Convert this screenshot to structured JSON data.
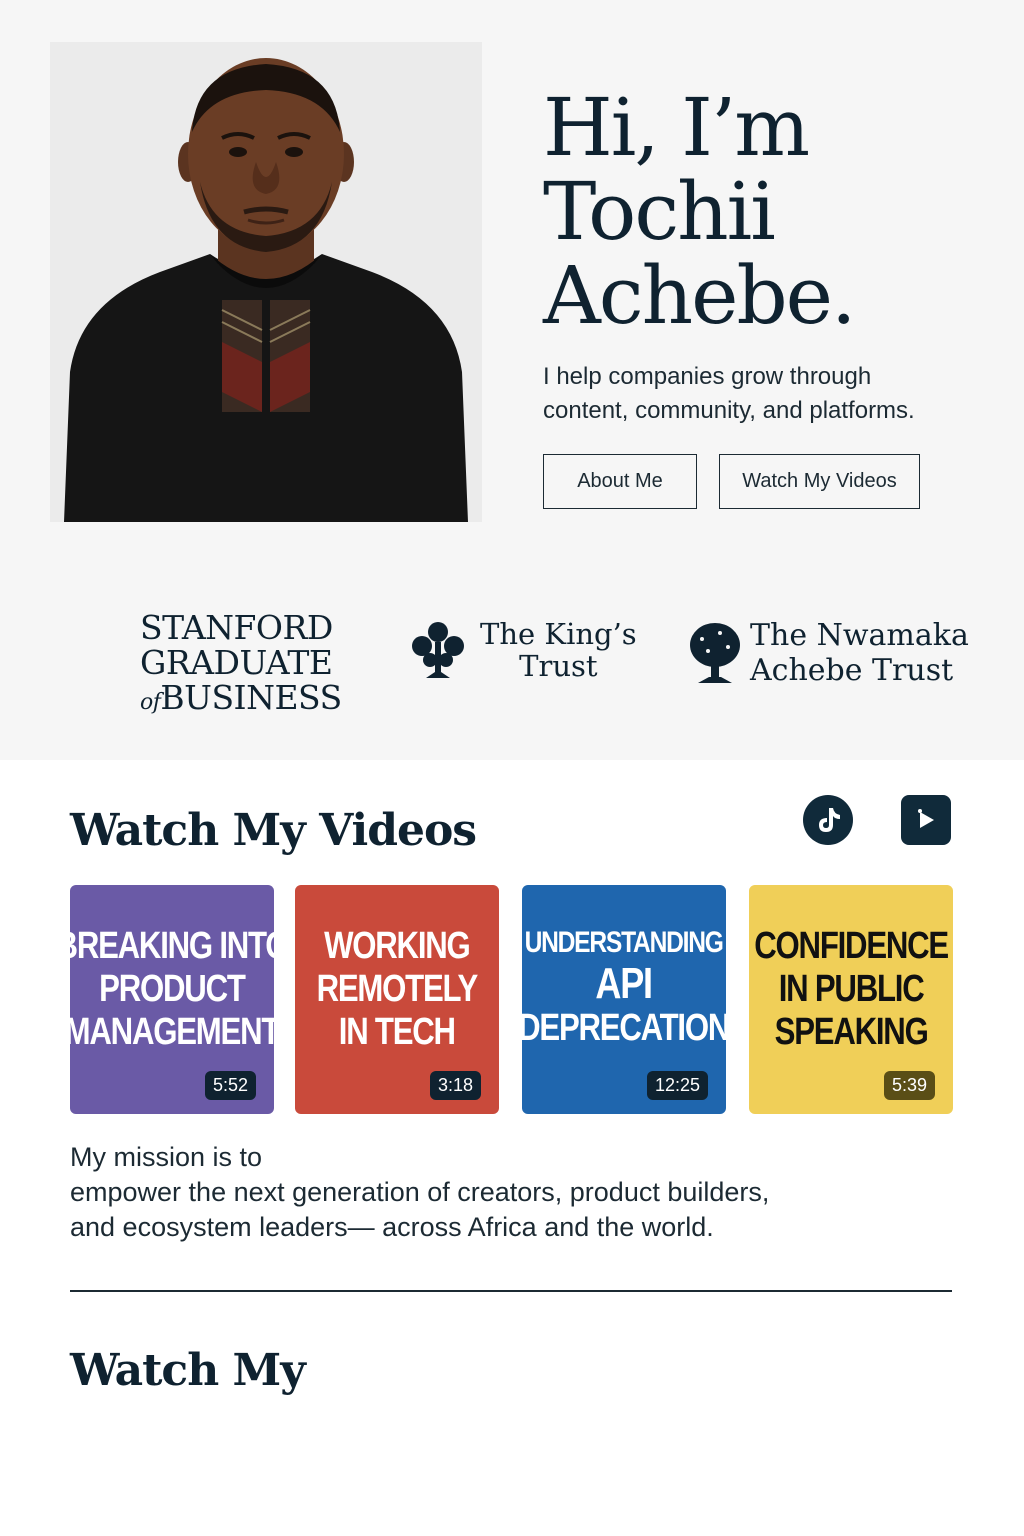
{
  "hero": {
    "headline": [
      "Hi, I’m",
      "Tochii",
      "Achebe."
    ],
    "tagline": [
      "I help companies grow through",
      "content, community, and platforms."
    ],
    "buttons": {
      "about": "About Me",
      "videos": "Watch My Videos"
    },
    "portrait_alt": "Portrait of Tochii Achebe"
  },
  "logos": {
    "stanford": {
      "line1": "STANFORD",
      "line2": "GRADUATE",
      "line3_of": "of",
      "line3": "BUSINESS"
    },
    "kings_trust": {
      "line1": "The King’s",
      "line2": "Trust"
    },
    "nwamaka": {
      "line1": "The Nwamaka",
      "line2": "Achebe Trust"
    }
  },
  "videos_section": {
    "title": "Watch My Videos",
    "social_icons": [
      "tiktok-icon",
      "video-play-icon"
    ],
    "cards": [
      {
        "lines": [
          "Breaking into",
          "Product",
          "Management"
        ],
        "duration": "5:52",
        "color": "#6a5aa6"
      },
      {
        "lines": [
          "Working",
          "Remotely",
          "in Tech"
        ],
        "duration": "3:18",
        "color": "#c94a3b"
      },
      {
        "lines": [
          "Understanding",
          "API",
          "Deprecation"
        ],
        "duration": "12:25",
        "color": "#1f66ae"
      },
      {
        "lines": [
          "Confidence",
          "in Public",
          "Speaking"
        ],
        "duration": "5:39",
        "color": "#f0cf58"
      }
    ]
  },
  "mission": [
    "My mission is to",
    "empower the next generation of creators, product builders,",
    "and ecosystem leaders— across Africa and the world."
  ],
  "second_section": {
    "title": "Watch My"
  },
  "colors": {
    "navy": "#0f2230",
    "hero_bg": "#f6f6f6"
  }
}
